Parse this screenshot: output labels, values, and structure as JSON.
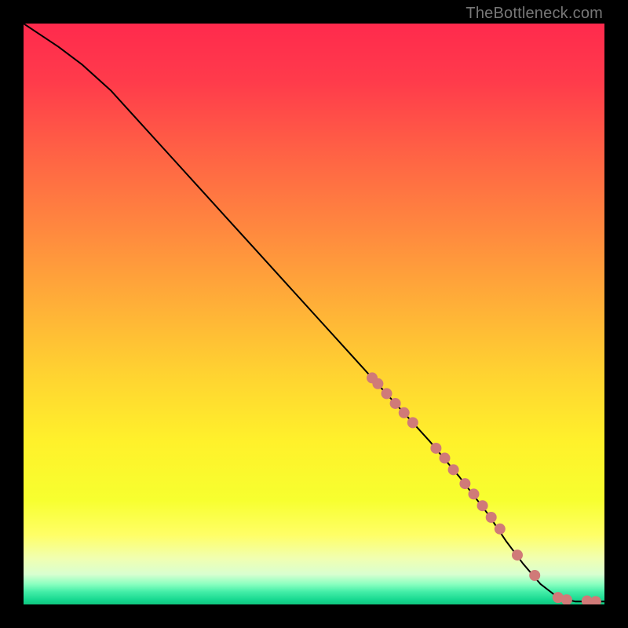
{
  "attribution": "TheBottleneck.com",
  "colors": {
    "curve_stroke": "#000000",
    "marker_fill": "#d07a78",
    "marker_stroke": "#d07a78"
  },
  "gradient_stops": [
    {
      "offset": 0.0,
      "color": "#ff2a4d"
    },
    {
      "offset": 0.1,
      "color": "#ff3b4b"
    },
    {
      "offset": 0.22,
      "color": "#ff6145"
    },
    {
      "offset": 0.35,
      "color": "#ff873f"
    },
    {
      "offset": 0.48,
      "color": "#ffae38"
    },
    {
      "offset": 0.6,
      "color": "#ffd231"
    },
    {
      "offset": 0.72,
      "color": "#fff12b"
    },
    {
      "offset": 0.82,
      "color": "#f7ff2f"
    },
    {
      "offset": 0.88,
      "color": "#ffff66"
    },
    {
      "offset": 0.92,
      "color": "#f1ffb0"
    },
    {
      "offset": 0.948,
      "color": "#d9ffd0"
    },
    {
      "offset": 0.965,
      "color": "#8affc0"
    },
    {
      "offset": 0.978,
      "color": "#44eea8"
    },
    {
      "offset": 0.992,
      "color": "#18d890"
    },
    {
      "offset": 1.0,
      "color": "#10c77f"
    }
  ],
  "chart_data": {
    "type": "line",
    "title": "",
    "xlabel": "",
    "ylabel": "",
    "xlim": [
      0,
      100
    ],
    "ylim": [
      0,
      100
    ],
    "series": [
      {
        "name": "curve",
        "x": [
          0,
          3,
          6,
          10,
          15,
          20,
          25,
          30,
          35,
          40,
          45,
          50,
          55,
          60,
          65,
          70,
          75,
          80,
          83,
          86,
          89,
          92,
          95,
          98,
          100
        ],
        "y": [
          100,
          98,
          96,
          93,
          88.5,
          83,
          77.5,
          72,
          66.5,
          61,
          55.5,
          50,
          44.5,
          39,
          33.5,
          28,
          22,
          15.5,
          11,
          7,
          3.5,
          1.2,
          0.5,
          0.5,
          0.5
        ]
      }
    ],
    "markers": {
      "name": "highlighted-points",
      "x": [
        60,
        61,
        62.5,
        64,
        65.5,
        67,
        71,
        72.5,
        74,
        76,
        77.5,
        79,
        80.5,
        82,
        85,
        88,
        92,
        93.5,
        97,
        98.5
      ],
      "y": [
        39,
        38,
        36.3,
        34.6,
        33,
        31.3,
        26.9,
        25.2,
        23.2,
        20.8,
        19,
        17,
        15,
        13,
        8.5,
        5,
        1.2,
        0.8,
        0.6,
        0.5
      ],
      "radius_px": 7
    }
  }
}
